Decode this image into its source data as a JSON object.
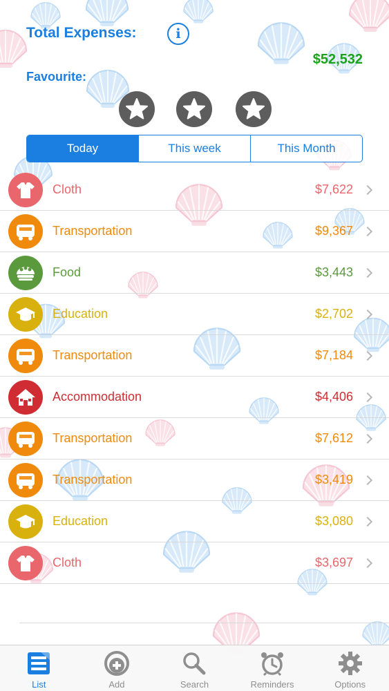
{
  "header": {
    "title": "Total Expenses:",
    "info_icon": "info-icon",
    "info_glyph": "i",
    "total": "$52,532",
    "total_color": "#1aa31a"
  },
  "favourite": {
    "label": "Favourite:",
    "stars": [
      "star-icon",
      "star-icon",
      "star-icon"
    ]
  },
  "segments": [
    {
      "label": "Today",
      "active": true
    },
    {
      "label": "This week",
      "active": false
    },
    {
      "label": "This Month",
      "active": false
    }
  ],
  "expenses": [
    {
      "category": "Cloth",
      "amount": "$7,622",
      "icon": "shirt-icon",
      "color": "#e8666c"
    },
    {
      "category": "Transportation",
      "amount": "$9,367",
      "icon": "bus-icon",
      "color": "#f08a0c"
    },
    {
      "category": "Food",
      "amount": "$3,443",
      "icon": "food-icon",
      "color": "#5a9a3c"
    },
    {
      "category": "Education",
      "amount": "$2,702",
      "icon": "graduation-cap-icon",
      "color": "#d9b10e"
    },
    {
      "category": "Transportation",
      "amount": "$7,184",
      "icon": "bus-icon",
      "color": "#f08a0c"
    },
    {
      "category": "Accommodation",
      "amount": "$4,406",
      "icon": "house-icon",
      "color": "#cf2d33"
    },
    {
      "category": "Transportation",
      "amount": "$7,612",
      "icon": "bus-icon",
      "color": "#f08a0c"
    },
    {
      "category": "Transportation",
      "amount": "$3,419",
      "icon": "bus-icon",
      "color": "#f08a0c"
    },
    {
      "category": "Education",
      "amount": "$3,080",
      "icon": "graduation-cap-icon",
      "color": "#d9b10e"
    },
    {
      "category": "Cloth",
      "amount": "$3,697",
      "icon": "shirt-icon",
      "color": "#e8666c"
    }
  ],
  "tabs": [
    {
      "label": "List",
      "icon": "list-icon",
      "active": true
    },
    {
      "label": "Add",
      "icon": "add-icon",
      "active": false
    },
    {
      "label": "Search",
      "icon": "search-icon",
      "active": false
    },
    {
      "label": "Reminders",
      "icon": "alarm-clock-icon",
      "active": false
    },
    {
      "label": "Options",
      "icon": "gear-icon",
      "active": false
    }
  ],
  "colors": {
    "accent": "#1a7fe0",
    "shell_blue": "#b8d8f5",
    "shell_pink": "#f5c6d4"
  }
}
